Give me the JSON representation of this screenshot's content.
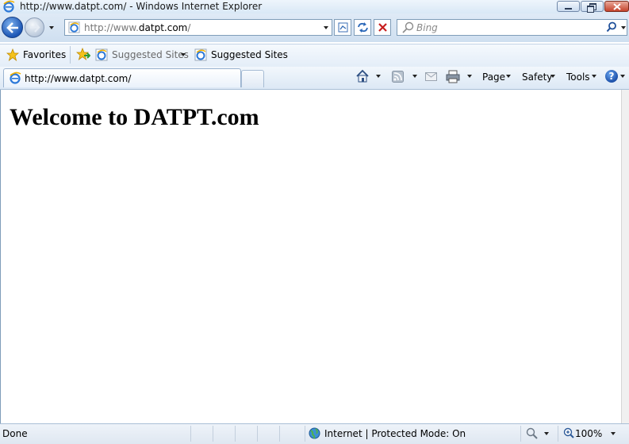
{
  "window": {
    "title": "http://www.datpt.com/ - Windows Internet Explorer"
  },
  "address_bar": {
    "url_prefix": "http://www.",
    "url_domain": "datpt.com",
    "url_suffix": "/"
  },
  "search": {
    "placeholder": "Bing"
  },
  "favorites_bar": {
    "favorites_label": "Favorites",
    "suggested_sites_dropdown": "Suggested Sites",
    "suggested_sites_link": "Suggested Sites"
  },
  "tab": {
    "label": "http://www.datpt.com/"
  },
  "command_bar": {
    "page_label": "Page",
    "safety_label": "Safety",
    "tools_label": "Tools"
  },
  "page": {
    "heading": "Welcome to DATPT.com"
  },
  "status_bar": {
    "status_text": "Done",
    "zone_text": "Internet | Protected Mode: On",
    "zoom_text": "100%"
  }
}
